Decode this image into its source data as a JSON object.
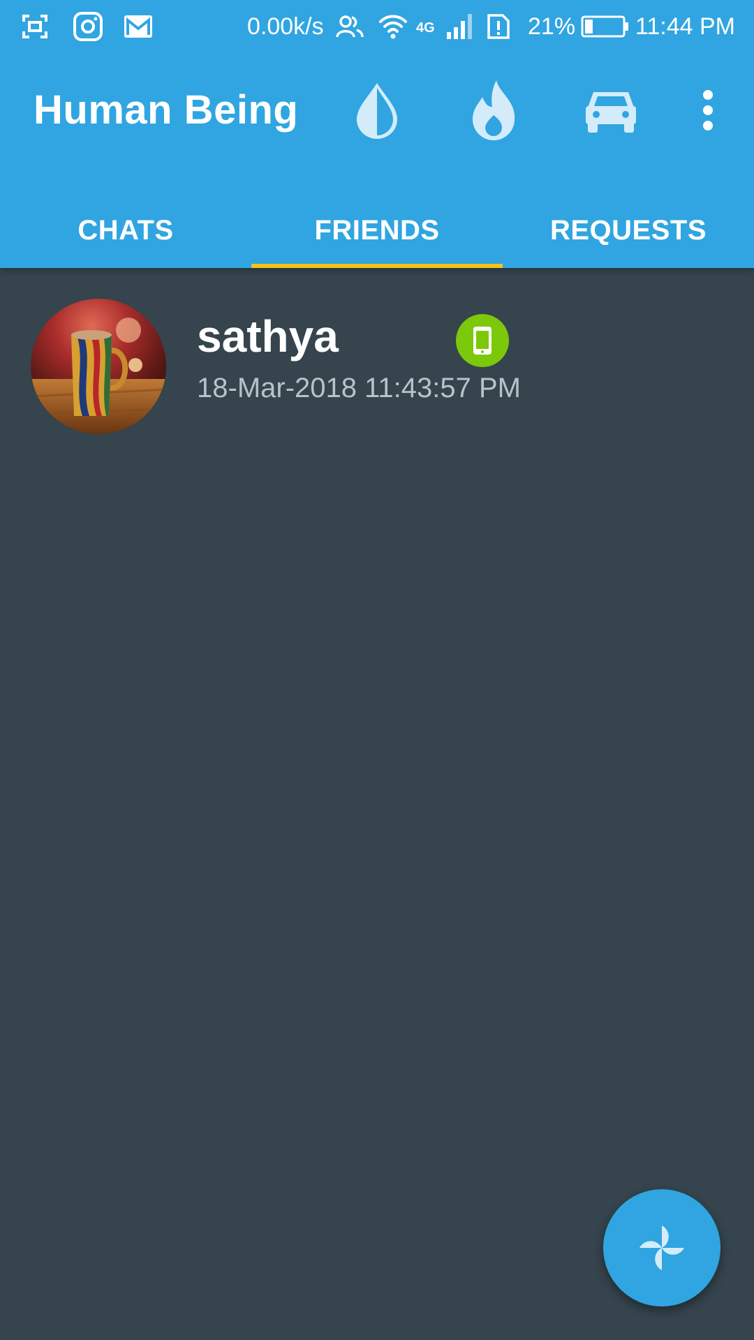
{
  "status_bar": {
    "net_speed": "0.00k/s",
    "network_type": "4G",
    "battery_percent": "21%",
    "battery_level": 0.21,
    "time": "11:44 PM",
    "icons": [
      "screenshot-icon",
      "instagram-icon",
      "gmail-icon",
      "contacts-icon",
      "wifi-icon",
      "signal-icon",
      "sim-alert-icon",
      "battery-icon"
    ]
  },
  "toolbar": {
    "title": "Human Being",
    "actions": [
      "water-drop-icon",
      "flame-icon",
      "car-icon",
      "more-vert-icon"
    ]
  },
  "tabs": [
    {
      "label": "CHATS",
      "selected": false
    },
    {
      "label": "FRIENDS",
      "selected": true
    },
    {
      "label": "REQUESTS",
      "selected": false
    }
  ],
  "friends": [
    {
      "name": "sathya",
      "timestamp": "18-Mar-2018 11:43:57 PM",
      "device_icon": "smartphone-icon",
      "avatar": "coffee-mug-photo"
    }
  ],
  "fab": {
    "icon": "pinwheel-icon"
  },
  "colors": {
    "primary": "#30a5e1",
    "background": "#35444d",
    "tab_indicator": "#f5c21b",
    "online_badge": "#7cc80b",
    "secondary_text": "#b8c3c9"
  }
}
